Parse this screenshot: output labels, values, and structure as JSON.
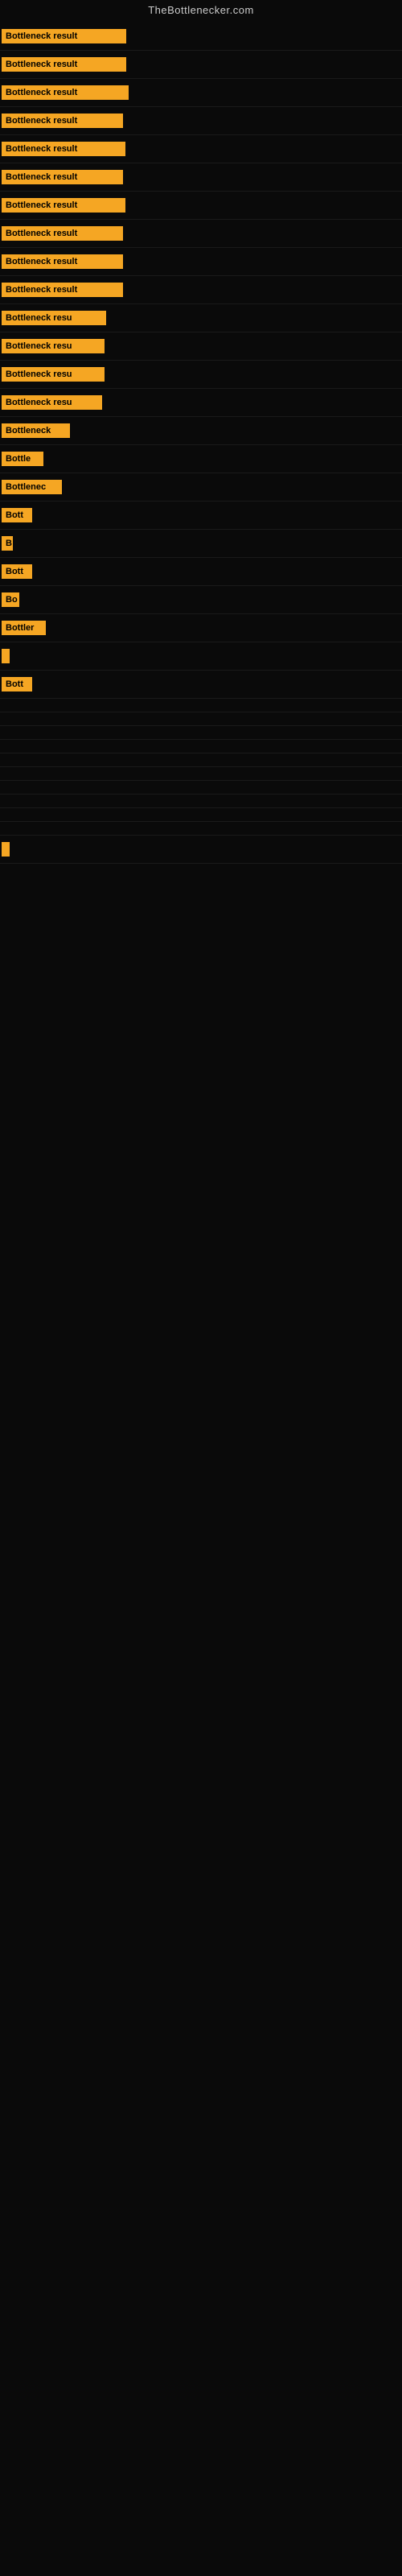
{
  "site": {
    "title": "TheBottlenecker.com"
  },
  "rows": [
    {
      "id": 1,
      "label": "Bottleneck result",
      "width": 155
    },
    {
      "id": 2,
      "label": "Bottleneck result",
      "width": 155
    },
    {
      "id": 3,
      "label": "Bottleneck result",
      "width": 158
    },
    {
      "id": 4,
      "label": "Bottleneck result",
      "width": 151
    },
    {
      "id": 5,
      "label": "Bottleneck result",
      "width": 154
    },
    {
      "id": 6,
      "label": "Bottleneck result",
      "width": 151
    },
    {
      "id": 7,
      "label": "Bottleneck result",
      "width": 154
    },
    {
      "id": 8,
      "label": "Bottleneck result",
      "width": 151
    },
    {
      "id": 9,
      "label": "Bottleneck result",
      "width": 151
    },
    {
      "id": 10,
      "label": "Bottleneck result",
      "width": 151
    },
    {
      "id": 11,
      "label": "Bottleneck resu",
      "width": 130
    },
    {
      "id": 12,
      "label": "Bottleneck resu",
      "width": 128
    },
    {
      "id": 13,
      "label": "Bottleneck resu",
      "width": 128
    },
    {
      "id": 14,
      "label": "Bottleneck resu",
      "width": 125
    },
    {
      "id": 15,
      "label": "Bottleneck",
      "width": 85
    },
    {
      "id": 16,
      "label": "Bottle",
      "width": 52
    },
    {
      "id": 17,
      "label": "Bottlenec",
      "width": 75
    },
    {
      "id": 18,
      "label": "Bott",
      "width": 38
    },
    {
      "id": 19,
      "label": "B",
      "width": 14
    },
    {
      "id": 20,
      "label": "Bott",
      "width": 38
    },
    {
      "id": 21,
      "label": "Bo",
      "width": 22
    },
    {
      "id": 22,
      "label": "Bottler",
      "width": 55
    },
    {
      "id": 23,
      "label": "",
      "width": 8
    },
    {
      "id": 24,
      "label": "Bott",
      "width": 38
    },
    {
      "id": 25,
      "label": "",
      "width": 0
    },
    {
      "id": 26,
      "label": "",
      "width": 0
    },
    {
      "id": 27,
      "label": "",
      "width": 0
    },
    {
      "id": 28,
      "label": "",
      "width": 0
    },
    {
      "id": 29,
      "label": "",
      "width": 0
    },
    {
      "id": 30,
      "label": "",
      "width": 0
    },
    {
      "id": 31,
      "label": "",
      "width": 0
    },
    {
      "id": 32,
      "label": "",
      "width": 0
    },
    {
      "id": 33,
      "label": "",
      "width": 0
    },
    {
      "id": 34,
      "label": "",
      "width": 0
    },
    {
      "id": 35,
      "label": "",
      "width": 8
    }
  ]
}
